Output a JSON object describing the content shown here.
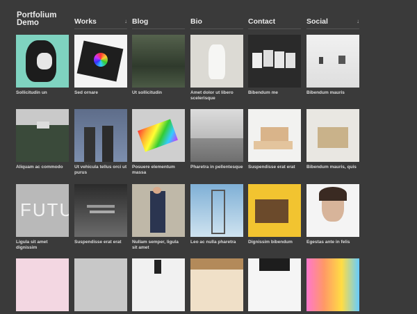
{
  "site": {
    "title_line1": "Portfolium",
    "title_line2": "Demo"
  },
  "nav": [
    {
      "label": "Works",
      "dropdown": true
    },
    {
      "label": "Blog",
      "dropdown": false
    },
    {
      "label": "Bio",
      "dropdown": false
    },
    {
      "label": "Contact",
      "dropdown": false
    },
    {
      "label": "Social",
      "dropdown": true
    }
  ],
  "grid": {
    "rows": [
      [
        {
          "caption": "Sollicitudin un",
          "thumb": "portrait-fragmented"
        },
        {
          "caption": "Sed ornare",
          "thumb": "book-color-wheel"
        },
        {
          "caption": "Ut sollicitudin",
          "thumb": "forest-trees"
        },
        {
          "caption": "Amet dolor ut libero scelerisque",
          "thumb": "white-bag"
        },
        {
          "caption": "Bibendum me",
          "thumb": "magazine-covers"
        },
        {
          "caption": "Bibendum mauris",
          "thumb": "gallery-room"
        }
      ],
      [
        {
          "caption": "Aliquam ac commodo",
          "thumb": "house-on-hill"
        },
        {
          "caption": "Ut vehicula tellus orci ut purus",
          "thumb": "two-figures"
        },
        {
          "caption": "Posuere elementum massa",
          "thumb": "rainbow-book"
        },
        {
          "caption": "Pharetra in pellentesque",
          "thumb": "foggy-coast"
        },
        {
          "caption": "Suspendisse erat erat",
          "thumb": "wooden-bench"
        },
        {
          "caption": "Bibendum mauris, quis",
          "thumb": "shelf-cubes"
        }
      ],
      [
        {
          "caption": "Ligula sit amet dignissim",
          "thumb": "futu-letters"
        },
        {
          "caption": "Suspendisse erat erat",
          "thumb": "stairs-interior"
        },
        {
          "caption": "Nullam semper, ligula sit amet",
          "thumb": "man-sitting"
        },
        {
          "caption": "Leo ac nulla pharetra",
          "thumb": "lattice-tower"
        },
        {
          "caption": "Dignissim bibendum",
          "thumb": "brown-yellow-art"
        },
        {
          "caption": "Egestas ante in felis",
          "thumb": "woman-portrait"
        }
      ],
      [
        {
          "caption": "",
          "thumb": "pink-shapes"
        },
        {
          "caption": "",
          "thumb": "grey-plain"
        },
        {
          "caption": "",
          "thumb": "dark-hand"
        },
        {
          "caption": "",
          "thumb": "orange-brush"
        },
        {
          "caption": "",
          "thumb": "hat-figure"
        },
        {
          "caption": "",
          "thumb": "colorful-stripes"
        }
      ]
    ]
  },
  "colors": {
    "background": "#3a3a3a",
    "text": "#e8e8e8",
    "divider": "#555555"
  }
}
